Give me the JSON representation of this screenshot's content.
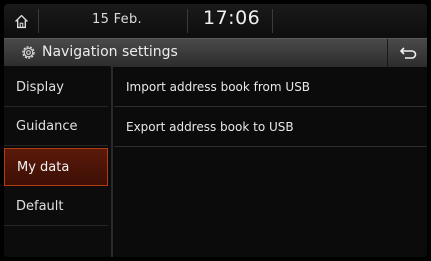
{
  "status": {
    "home_icon": "home-icon",
    "date": "15 Feb.",
    "time": "17:06"
  },
  "header": {
    "icon": "gear-icon",
    "title": "Navigation settings",
    "back_icon": "back-arrow-icon"
  },
  "sidebar": {
    "selected_index": 2,
    "items": [
      {
        "label": "Display"
      },
      {
        "label": "Guidance"
      },
      {
        "label": "My data"
      },
      {
        "label": "Default"
      }
    ]
  },
  "main": {
    "items": [
      {
        "label": "Import address book from USB"
      },
      {
        "label": "Export address book to USB"
      }
    ]
  },
  "colors": {
    "selected_bg": "#4a1407",
    "selected_border": "#b23a14"
  }
}
